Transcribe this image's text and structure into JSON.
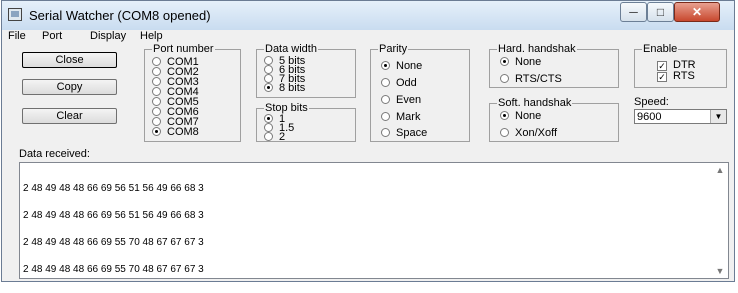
{
  "window": {
    "title": "Serial Watcher (COM8 opened)",
    "controls": {
      "minimize": "─",
      "maximize": "□",
      "close": "✕"
    }
  },
  "menu": [
    "File",
    "Port",
    "Display",
    "Help"
  ],
  "buttons": {
    "close": "Close",
    "copy": "Copy",
    "clear": "Clear"
  },
  "port_number": {
    "label": "Port number",
    "options": [
      "COM1",
      "COM2",
      "COM3",
      "COM4",
      "COM5",
      "COM6",
      "COM7",
      "COM8"
    ],
    "selected": "COM8"
  },
  "data_width": {
    "label": "Data width",
    "options": [
      "5 bits",
      "6 bits",
      "7 bits",
      "8 bits"
    ],
    "selected": "8 bits"
  },
  "stop_bits": {
    "label": "Stop bits",
    "options": [
      "1",
      "1.5",
      "2"
    ],
    "selected": "1"
  },
  "parity": {
    "label": "Parity",
    "options": [
      "None",
      "Odd",
      "Even",
      "Mark",
      "Space"
    ],
    "selected": "None"
  },
  "hard_handshake": {
    "label": "Hard. handshak",
    "options": [
      "None",
      "RTS/CTS"
    ],
    "selected": "None"
  },
  "soft_handshake": {
    "label": "Soft. handshak",
    "options": [
      "None",
      "Xon/Xoff"
    ],
    "selected": "None"
  },
  "enable": {
    "label": "Enable",
    "items": [
      {
        "label": "DTR",
        "checked": true
      },
      {
        "label": "RTS",
        "checked": true
      }
    ]
  },
  "speed": {
    "label": "Speed:",
    "value": "9600"
  },
  "data_received": {
    "label": "Data received:",
    "lines": [
      "2 48 49 48 48 66 69 56 51 56 49 66 68 3",
      "2 48 49 48 48 66 69 56 51 56 49 66 68 3",
      "2 48 49 48 48 66 69 55 70 48 67 67 67 3",
      "2 48 49 48 48 66 69 55 70 48 67 67 67 3"
    ]
  }
}
